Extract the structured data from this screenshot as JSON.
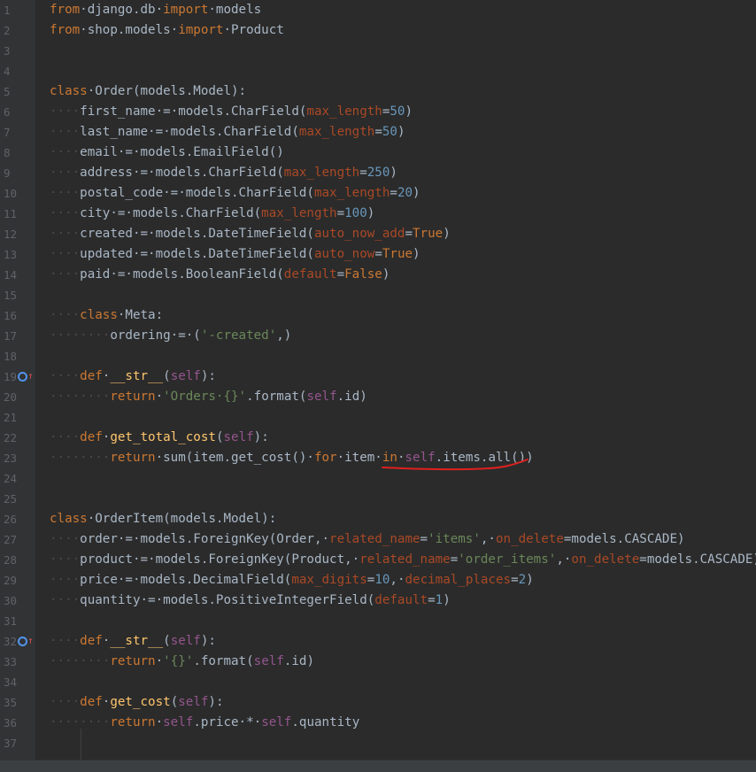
{
  "lines": [
    {
      "n": "1",
      "t": [
        [
          "kw",
          "from"
        ],
        [
          "",
          "·django.db·"
        ],
        [
          "kw",
          "import"
        ],
        [
          "",
          "·models"
        ]
      ]
    },
    {
      "n": "2",
      "t": [
        [
          "kw",
          "from"
        ],
        [
          "",
          "·shop.models·"
        ],
        [
          "kw",
          "import"
        ],
        [
          "",
          "·Product"
        ]
      ]
    },
    {
      "n": "3",
      "t": []
    },
    {
      "n": "4",
      "t": []
    },
    {
      "n": "5",
      "t": [
        [
          "kw",
          "class"
        ],
        [
          "",
          "·Order(models.Model):"
        ]
      ]
    },
    {
      "n": "6",
      "t": [
        [
          "ws",
          "····"
        ],
        [
          "",
          "first_name·=·models.CharField("
        ],
        [
          "param",
          "max_length"
        ],
        [
          "",
          "="
        ],
        [
          "num",
          "50"
        ],
        [
          "",
          ")"
        ]
      ]
    },
    {
      "n": "7",
      "t": [
        [
          "ws",
          "····"
        ],
        [
          "",
          "last_name·=·models.CharField("
        ],
        [
          "param",
          "max_length"
        ],
        [
          "",
          "="
        ],
        [
          "num",
          "50"
        ],
        [
          "",
          ")"
        ]
      ]
    },
    {
      "n": "8",
      "t": [
        [
          "ws",
          "····"
        ],
        [
          "",
          "email·=·models.EmailField()"
        ]
      ]
    },
    {
      "n": "9",
      "t": [
        [
          "ws",
          "····"
        ],
        [
          "",
          "address·=·models.CharField("
        ],
        [
          "param",
          "max_length"
        ],
        [
          "",
          "="
        ],
        [
          "num",
          "250"
        ],
        [
          "",
          ")"
        ]
      ]
    },
    {
      "n": "10",
      "t": [
        [
          "ws",
          "····"
        ],
        [
          "",
          "postal_code·=·models.CharField("
        ],
        [
          "param",
          "max_length"
        ],
        [
          "",
          "="
        ],
        [
          "num",
          "20"
        ],
        [
          "",
          ")"
        ]
      ]
    },
    {
      "n": "11",
      "t": [
        [
          "ws",
          "····"
        ],
        [
          "",
          "city·=·models.CharField("
        ],
        [
          "param",
          "max_length"
        ],
        [
          "",
          "="
        ],
        [
          "num",
          "100"
        ],
        [
          "",
          ")"
        ]
      ]
    },
    {
      "n": "12",
      "t": [
        [
          "ws",
          "····"
        ],
        [
          "",
          "created·=·models.DateTimeField("
        ],
        [
          "param",
          "auto_now_add"
        ],
        [
          "",
          "="
        ],
        [
          "kw",
          "True"
        ],
        [
          "",
          ")"
        ]
      ]
    },
    {
      "n": "13",
      "t": [
        [
          "ws",
          "····"
        ],
        [
          "",
          "updated·=·models.DateTimeField("
        ],
        [
          "param",
          "auto_now"
        ],
        [
          "",
          "="
        ],
        [
          "kw",
          "True"
        ],
        [
          "",
          ")"
        ]
      ]
    },
    {
      "n": "14",
      "t": [
        [
          "ws",
          "····"
        ],
        [
          "",
          "paid·=·models.BooleanField("
        ],
        [
          "param",
          "default"
        ],
        [
          "",
          "="
        ],
        [
          "kw",
          "False"
        ],
        [
          "",
          ")"
        ]
      ]
    },
    {
      "n": "15",
      "t": []
    },
    {
      "n": "16",
      "t": [
        [
          "ws",
          "····"
        ],
        [
          "kw",
          "class"
        ],
        [
          "",
          "·Meta:"
        ]
      ]
    },
    {
      "n": "17",
      "t": [
        [
          "ws",
          "········"
        ],
        [
          "",
          "ordering·=·("
        ],
        [
          "str",
          "'-created'"
        ],
        [
          "",
          ",)"
        ]
      ]
    },
    {
      "n": "18",
      "t": []
    },
    {
      "n": "19",
      "t": [
        [
          "ws",
          "····"
        ],
        [
          "kw",
          "def"
        ],
        [
          "",
          "·"
        ],
        [
          "fn",
          "__str__"
        ],
        [
          "",
          "("
        ],
        [
          "self",
          "self"
        ],
        [
          "",
          "):"
        ]
      ]
    },
    {
      "n": "20",
      "t": [
        [
          "ws",
          "········"
        ],
        [
          "kw",
          "return"
        ],
        [
          "",
          "·"
        ],
        [
          "str",
          "'Orders·{}'"
        ],
        [
          "",
          ".format("
        ],
        [
          "self",
          "self"
        ],
        [
          "",
          ".id)"
        ]
      ]
    },
    {
      "n": "21",
      "t": []
    },
    {
      "n": "22",
      "t": [
        [
          "ws",
          "····"
        ],
        [
          "kw",
          "def"
        ],
        [
          "",
          "·"
        ],
        [
          "fn",
          "get_total_cost"
        ],
        [
          "",
          "("
        ],
        [
          "self",
          "self"
        ],
        [
          "",
          "):"
        ]
      ]
    },
    {
      "n": "23",
      "t": [
        [
          "ws",
          "········"
        ],
        [
          "kw",
          "return"
        ],
        [
          "",
          "·sum(item.get_cost()·"
        ],
        [
          "kw",
          "for"
        ],
        [
          "",
          "·item·"
        ],
        [
          "kw",
          "in"
        ],
        [
          "",
          "·"
        ],
        [
          "self",
          "self"
        ],
        [
          "",
          ".items.all())"
        ]
      ]
    },
    {
      "n": "24",
      "t": []
    },
    {
      "n": "25",
      "t": []
    },
    {
      "n": "26",
      "t": [
        [
          "kw",
          "class"
        ],
        [
          "",
          "·OrderItem(models.Model):"
        ]
      ]
    },
    {
      "n": "27",
      "t": [
        [
          "ws",
          "····"
        ],
        [
          "",
          "order·=·models.ForeignKey(Order,·"
        ],
        [
          "param",
          "related_name"
        ],
        [
          "",
          "="
        ],
        [
          "str",
          "'items'"
        ],
        [
          "",
          ",·"
        ],
        [
          "param",
          "on_delete"
        ],
        [
          "",
          "=models.CASCADE)"
        ]
      ]
    },
    {
      "n": "28",
      "t": [
        [
          "ws",
          "····"
        ],
        [
          "",
          "product·=·models.ForeignKey(Product,·"
        ],
        [
          "param",
          "related_name"
        ],
        [
          "",
          "="
        ],
        [
          "str",
          "'order_items'"
        ],
        [
          "",
          ",·"
        ],
        [
          "param",
          "on_delete"
        ],
        [
          "",
          "=models.CASCADE)"
        ]
      ]
    },
    {
      "n": "29",
      "t": [
        [
          "ws",
          "····"
        ],
        [
          "",
          "price·=·models.DecimalField("
        ],
        [
          "param",
          "max_digits"
        ],
        [
          "",
          "="
        ],
        [
          "num",
          "10"
        ],
        [
          "",
          ",·"
        ],
        [
          "param",
          "decimal_places"
        ],
        [
          "",
          "="
        ],
        [
          "num",
          "2"
        ],
        [
          "",
          ")"
        ]
      ]
    },
    {
      "n": "30",
      "t": [
        [
          "ws",
          "····"
        ],
        [
          "",
          "quantity·=·models.PositiveIntegerField("
        ],
        [
          "param",
          "default"
        ],
        [
          "",
          "="
        ],
        [
          "num",
          "1"
        ],
        [
          "",
          ")"
        ]
      ]
    },
    {
      "n": "31",
      "t": []
    },
    {
      "n": "32",
      "t": [
        [
          "ws",
          "····"
        ],
        [
          "kw",
          "def"
        ],
        [
          "",
          "·"
        ],
        [
          "fn",
          "__str__"
        ],
        [
          "",
          "("
        ],
        [
          "self",
          "self"
        ],
        [
          "",
          "):"
        ]
      ]
    },
    {
      "n": "33",
      "t": [
        [
          "ws",
          "········"
        ],
        [
          "kw",
          "return"
        ],
        [
          "",
          "·"
        ],
        [
          "str",
          "'{}'"
        ],
        [
          "",
          ".format("
        ],
        [
          "self",
          "self"
        ],
        [
          "",
          ".id)"
        ]
      ]
    },
    {
      "n": "34",
      "t": []
    },
    {
      "n": "35",
      "t": [
        [
          "ws",
          "····"
        ],
        [
          "kw",
          "def"
        ],
        [
          "",
          "·"
        ],
        [
          "fn",
          "get_cost"
        ],
        [
          "",
          "("
        ],
        [
          "self",
          "self"
        ],
        [
          "",
          "):"
        ]
      ]
    },
    {
      "n": "36",
      "t": [
        [
          "ws",
          "········"
        ],
        [
          "kw",
          "return"
        ],
        [
          "",
          "·"
        ],
        [
          "self",
          "self"
        ],
        [
          "",
          ".price·*·"
        ],
        [
          "self",
          "self"
        ],
        [
          "",
          ".quantity"
        ]
      ]
    },
    {
      "n": "37",
      "t": []
    }
  ],
  "gutter_icons": {
    "19": "override-up-icon",
    "32": "override-up-icon"
  },
  "colors": {
    "background": "#2b2b2b",
    "keyword": "#cc7832",
    "self": "#94558d",
    "param": "#aa4926",
    "number": "#6897bb",
    "string": "#6a8759",
    "function": "#ffc66d",
    "text": "#a9b7c6",
    "annotation": "#e0201f"
  }
}
